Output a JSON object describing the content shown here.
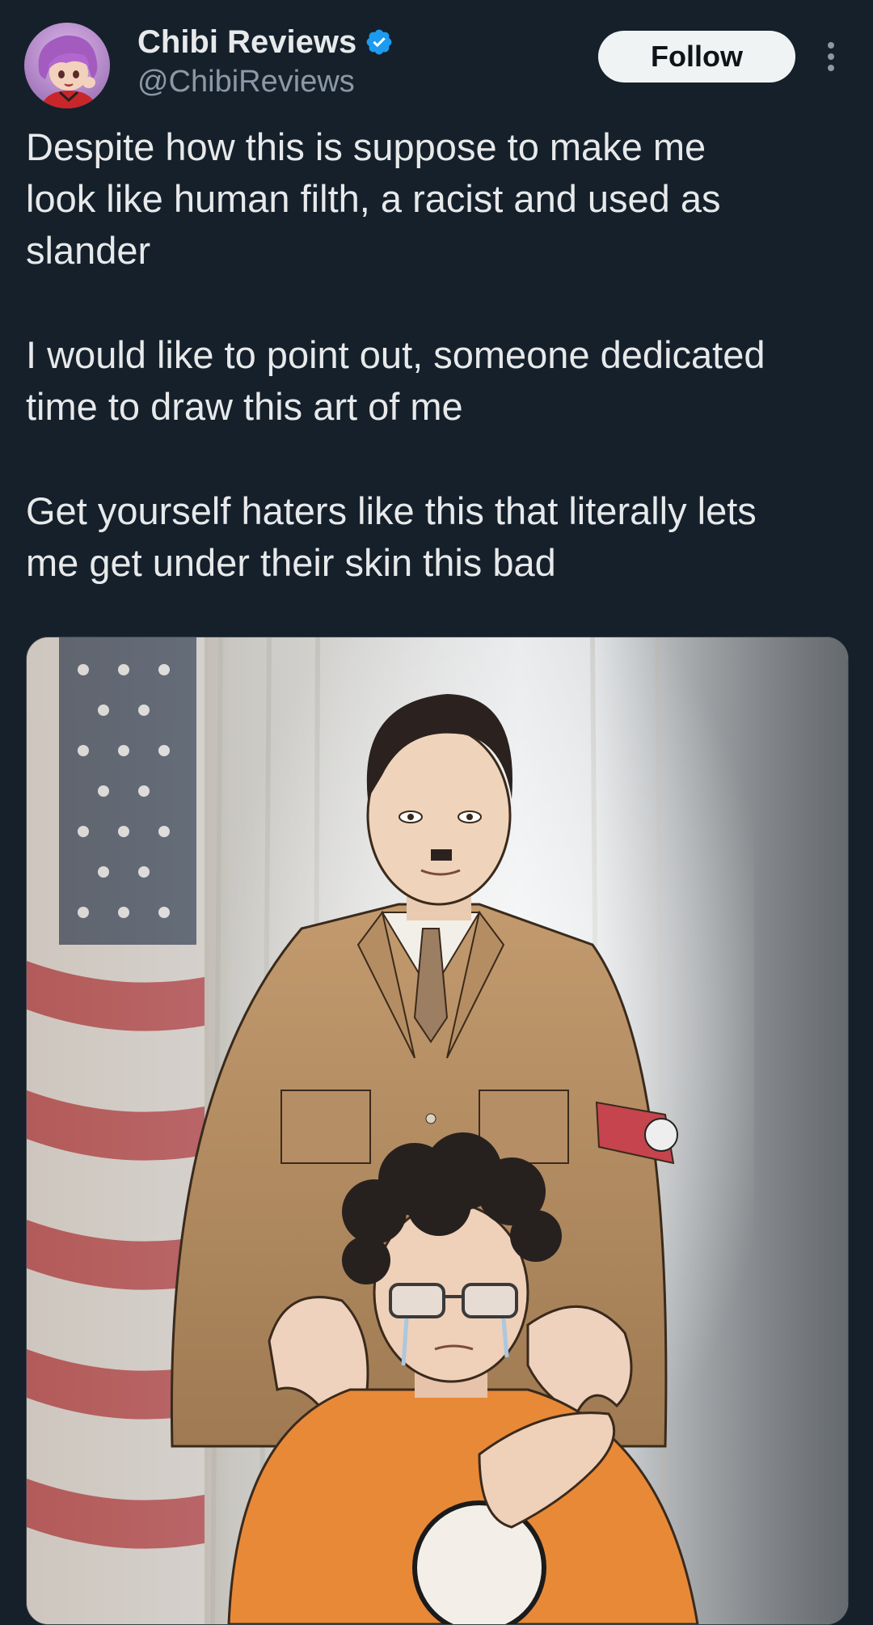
{
  "post": {
    "author": {
      "display_name": "Chibi Reviews",
      "handle": "@ChibiReviews",
      "verified": true,
      "avatar_icon": "anime-avatar-icon"
    },
    "follow_label": "Follow",
    "more_icon": "more-vertical-icon",
    "text_paragraphs": [
      "Despite how this is suppose to make me\nlook like human filth, a racist and used as\nslander",
      "I would like to point out, someone dedicated\ntime to draw this art of me",
      "Get yourself haters like this that literally lets\nme get under their skin this bad"
    ]
  },
  "colors": {
    "background": "#15202b",
    "text_primary": "#e7e9ea",
    "text_secondary": "#8b98a5",
    "verified_blue": "#1d9bf0",
    "follow_bg": "#eff3f4"
  }
}
